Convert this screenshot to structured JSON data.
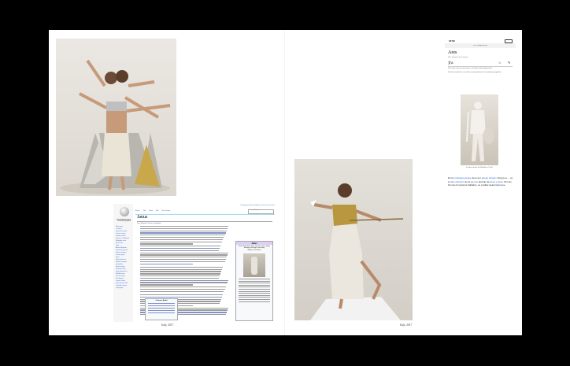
{
  "folio": {
    "left": "Italy, 2017",
    "right": "Italy, 2017"
  },
  "desktop_wiki": {
    "wordmark": "WIKIPEDIA",
    "tagline": "The Free Encyclopedia",
    "nav": [
      "Main page",
      "Contents",
      "Featured content",
      "Current events",
      "Random article",
      "Donate to Wikipedia",
      "Wikipedia store",
      "Interaction",
      "Help",
      "About Wikipedia",
      "Community portal",
      "Recent changes",
      "Contact page",
      "Tools",
      "What links here",
      "Related changes",
      "Upload file",
      "Special pages",
      "Permanent link",
      "Page information",
      "Wikidata item",
      "Cite this page",
      "Print/export",
      "Create a book",
      "Download as PDF",
      "Printable version",
      "Languages"
    ],
    "topbar": "Not logged in  Talk  Contributions  Create account  Log in",
    "tabs": [
      "Article",
      "Talk",
      "Read",
      "Edit",
      "View history"
    ],
    "search_placeholder": "Search Wikipedia",
    "title": "Janus",
    "from": "From Wikipedia, the free encyclopedia",
    "toc_title": "Contents [hide]",
    "infobox_title": "Janus",
    "infobox_sub": "God of beginnings, gates, transitions, time, duality, doorways, passages, and ending",
    "infobox_sub2": "Member of Di Selecti"
  },
  "mobile_wiki": {
    "time": "12:02",
    "url": "es.m.wikipedia.org",
    "title": "Ares",
    "subtitle": "Dios olímpico de la guerra",
    "icons": [
      "文A",
      "☆",
      "✎"
    ],
    "note1": "Para otros usos de este término, véase Ares (desambiguación).",
    "note2": "No debe confundirse con el dios correspondiente de la mitología griega Ares.",
    "caption": "Escultura de Ares del Villa Adriana (Tívoli)",
    "text_prefix": "En la ",
    "text_link1": "mitología griega",
    "text_mid1": ", Ares (en ",
    "text_link2": "griego antiguo",
    "text_mid2": " Ἄρης) es ... es el ",
    "text_link3": "dios olímpico",
    "text_mid3": " de la ",
    "text_link4": "guerra",
    "text_mid4": ". Es hijo de ",
    "text_link5": "Zeus y Hera",
    "text_end": ". Por los himnos homéricos hallados, es posible determinar que"
  }
}
